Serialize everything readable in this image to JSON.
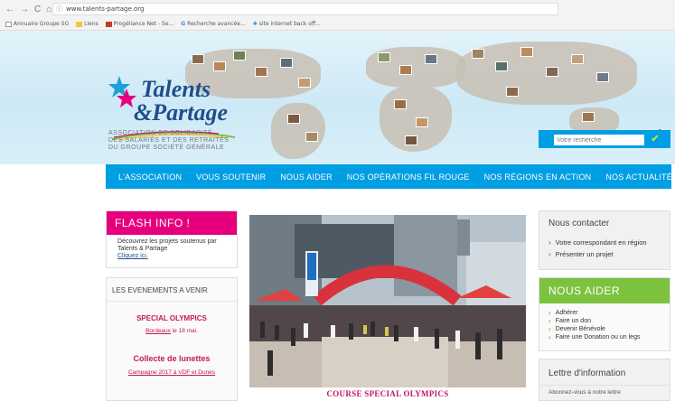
{
  "browser": {
    "url": "www.talents-partage.org",
    "bookmarks": [
      {
        "label": "Annuaire Groupe SG",
        "color": "#9b9b9b"
      },
      {
        "label": "Liens",
        "color": "#f4c542"
      },
      {
        "label": "Progéliance Net - Se...",
        "color": "#c0392b"
      },
      {
        "label": "Recherche avancée...",
        "color": "#4285f4"
      },
      {
        "label": "site internet back off...",
        "color": "#1f9fd8"
      }
    ]
  },
  "site": {
    "logo_line1": "Talents",
    "logo_line2": "&Partage",
    "tagline": [
      "ASSOCIATION DE SOLIDARITÉ",
      "DES SALARIÉS ET DES RETRAITÉS",
      "DU GROUPE SOCIÉTÉ GÉNÉRALE"
    ],
    "search_placeholder": "Votre recherche",
    "brand_blue": "#009ee3",
    "brand_pink": "#e6007e",
    "brand_green": "#7dc23e"
  },
  "nav": {
    "items": [
      "L'ASSOCIATION",
      "VOUS SOUTENIR",
      "NOUS AIDER",
      "NOS OPÉRATIONS FIL ROUGE",
      "NOS RÉGIONS EN ACTION",
      "NOS ACTUALITÉS"
    ]
  },
  "flash": {
    "title": "FLASH INFO !",
    "line1": "Découvrez les projets soutenus par",
    "line2": "Talents & Partage",
    "link": "Cliquez ici."
  },
  "events": {
    "title": "LES EVENEMENTS A VENIR",
    "e1_name": "SPECIAL OLYMPICS",
    "e1_place": "Bordeaux",
    "e1_date": " le  18 mai.",
    "e2_name": "Collecte de lunettes",
    "e2_sub": "Campagne 2017 à VDF et Dunes"
  },
  "feature": {
    "caption": "COURSE SPECIAL OLYMPICS"
  },
  "contact": {
    "title": "Nous contacter",
    "links": [
      "Votre correspondant en région",
      "Présenter un projet"
    ]
  },
  "aider": {
    "title": "NOUS AIDER",
    "links": [
      "Adhérer",
      "Faire un don",
      "Devenir Bénévole",
      "Faire une Donation ou un legs"
    ]
  },
  "newsletter": {
    "title": "Lettre d'information",
    "text": "Abonnez-vous à notre lettre"
  }
}
